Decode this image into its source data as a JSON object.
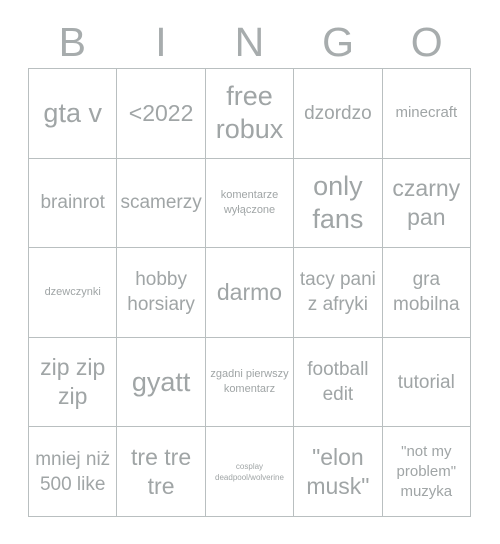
{
  "card": {
    "header_letters": [
      "B",
      "I",
      "N",
      "G",
      "O"
    ],
    "text_color": "#a0a5a6",
    "header_color": "#a7acad",
    "border_color": "#b9bfc0",
    "background": "#ffffff",
    "rows": 5,
    "columns": 5,
    "cells": [
      {
        "text": "gta v",
        "size": "xl"
      },
      {
        "text": "<2022",
        "size": "lg"
      },
      {
        "text": "free robux",
        "size": "xl"
      },
      {
        "text": "dzordzo",
        "size": "md"
      },
      {
        "text": "minecraft",
        "size": "sm"
      },
      {
        "text": "brainrot",
        "size": "md"
      },
      {
        "text": "scamerzy",
        "size": "md"
      },
      {
        "text": "komentarze wyłączone",
        "size": "xs"
      },
      {
        "text": "only fans",
        "size": "xl"
      },
      {
        "text": "czarny pan",
        "size": "lg"
      },
      {
        "text": "dzewczynki",
        "size": "xs"
      },
      {
        "text": "hobby horsiary",
        "size": "md"
      },
      {
        "text": "darmo",
        "size": "lg"
      },
      {
        "text": "tacy pani z afryki",
        "size": "md"
      },
      {
        "text": "gra mobilna",
        "size": "md"
      },
      {
        "text": "zip zip zip",
        "size": "lg"
      },
      {
        "text": "gyatt",
        "size": "xl"
      },
      {
        "text": "zgadni pierwszy komentarz",
        "size": "xs"
      },
      {
        "text": "football edit",
        "size": "md"
      },
      {
        "text": "tutorial",
        "size": "md"
      },
      {
        "text": "mniej niż 500 like",
        "size": "md"
      },
      {
        "text": "tre tre tre",
        "size": "lg"
      },
      {
        "text": "cosplay deadpool/wolverine",
        "size": "xxs"
      },
      {
        "text": "\"elon musk\"",
        "size": "lg"
      },
      {
        "text": "\"not my problem\" muzyka",
        "size": "sm"
      }
    ]
  }
}
